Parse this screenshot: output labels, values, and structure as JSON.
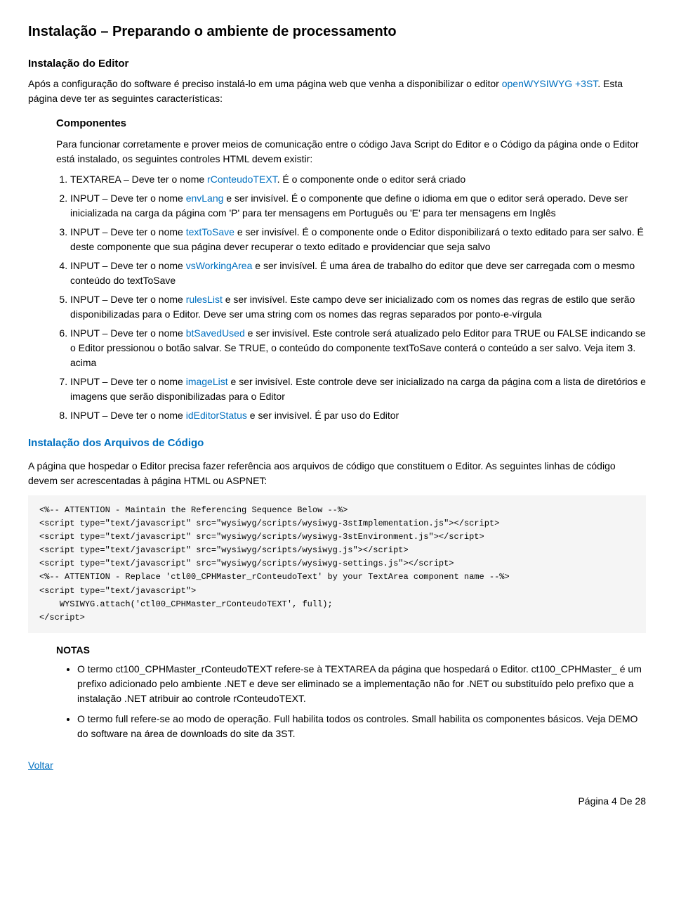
{
  "page": {
    "title": "Instalação – Preparando o ambiente de processamento",
    "section1_heading": "Instalação do Editor",
    "intro1": "Após a configuração do software é preciso instalá-lo em uma página web que venha a disponibilizar o editor ",
    "intro1_link": "openWYSIWYG +3ST",
    "intro2": ". Esta página deve ter as seguintes características:",
    "components_heading": "Componentes",
    "components_intro": "Para funcionar corretamente e prover meios de comunicação entre o código Java Script do Editor e o Código da página onde o Editor está instalado, os seguintes controles HTML devem existir:",
    "list_items": [
      {
        "prefix": "TEXTAREA – Deve ter o nome ",
        "link": "rConteudoTEXT",
        "suffix": ". É o componente onde o editor será criado"
      },
      {
        "prefix": "INPUT – Deve ter o nome ",
        "link": "envLang",
        "suffix": " e ser invisível. É o componente que define o idioma em que o editor será operado. Deve ser inicializada na carga da página com 'P' para ter mensagens em Português ou 'E' para ter mensagens em Inglês"
      },
      {
        "prefix": "INPUT – Deve ter o nome ",
        "link": "textToSave",
        "suffix": " e ser invisível. É o componente onde o Editor disponibilizará o texto editado para ser salvo. É deste componente que sua página dever recuperar o texto editado e providenciar que seja salvo"
      },
      {
        "prefix": "INPUT – Deve ter o nome ",
        "link": "vsWorkingArea",
        "suffix": " e ser invisível. É uma área de trabalho do editor que deve ser carregada com o mesmo conteúdo do textToSave"
      },
      {
        "prefix": "INPUT – Deve ter o nome ",
        "link": "rulesList",
        "suffix": " e ser invisível. Este campo deve ser inicializado com os nomes das regras de estilo que serão disponibilizadas para o Editor. Deve ser uma string com os nomes das regras separados por ponto-e-vírgula"
      },
      {
        "prefix": "INPUT – Deve ter o nome ",
        "link": "btSavedUsed",
        "suffix": " e ser invisível. Este controle será atualizado pelo Editor para TRUE ou FALSE indicando se o Editor pressionou o botão salvar. Se TRUE, o conteúdo do componente textToSave conterá o conteúdo a ser salvo. Veja item 3. acima"
      },
      {
        "prefix": "INPUT – Deve ter o nome ",
        "link": "imageList",
        "suffix": " e ser invisível. Este controle deve ser inicializado na carga da página com a lista de diretórios e imagens que serão disponibilizadas para o Editor"
      },
      {
        "prefix": "INPUT – Deve ter o nome ",
        "link": "idEditorStatus",
        "suffix": " e ser invisível. É par uso do Editor"
      }
    ],
    "section2_title": "Instalação dos Arquivos de Código",
    "section2_intro": "A página que hospedar o Editor precisa fazer referência aos arquivos de código que constituem o Editor. As seguintes linhas de código devem ser acrescentadas à página HTML ou ASPNET:",
    "code_block": "<%-- ATTENTION - Maintain the Referencing Sequence Below --%>\n<script type=\"text/javascript\" src=\"wysiwyg/scripts/wysiwyg-3stImplementation.js\"></script>\n<script type=\"text/javascript\" src=\"wysiwyg/scripts/wysiwyg-3stEnvironment.js\"></script>\n<script type=\"text/javascript\" src=\"wysiwyg/scripts/wysiwyg.js\"></script>\n<script type=\"text/javascript\" src=\"wysiwyg/scripts/wysiwyg-settings.js\"></script>\n<%-- ATTENTION - Replace 'ctl00_CPHMaster_rConteudoText' by your TextArea component name --%>\n<script type=\"text/javascript\">\n    WYSIWYG.attach('ctl00_CPHMaster_rConteudoTEXT', full);\n</script>",
    "notes_title": "NOTAS",
    "notes": [
      "O termo ct100_CPHMaster_rConteudoTEXT refere-se à TEXTAREA da página que hospedará o Editor. ct100_CPHMaster_ é um prefixo adicionado pelo ambiente .NET e deve ser eliminado se a implementação não for .NET ou substituído pelo prefixo que a instalação .NET atribuir ao controle rConteudoTEXT.",
      "O termo full refere-se ao modo de operação. Full habilita todos os controles. Small habilita os componentes básicos. Veja DEMO do software na área de downloads do site da 3ST."
    ],
    "back_link": "Voltar",
    "footer": "Página 4 De 28"
  }
}
